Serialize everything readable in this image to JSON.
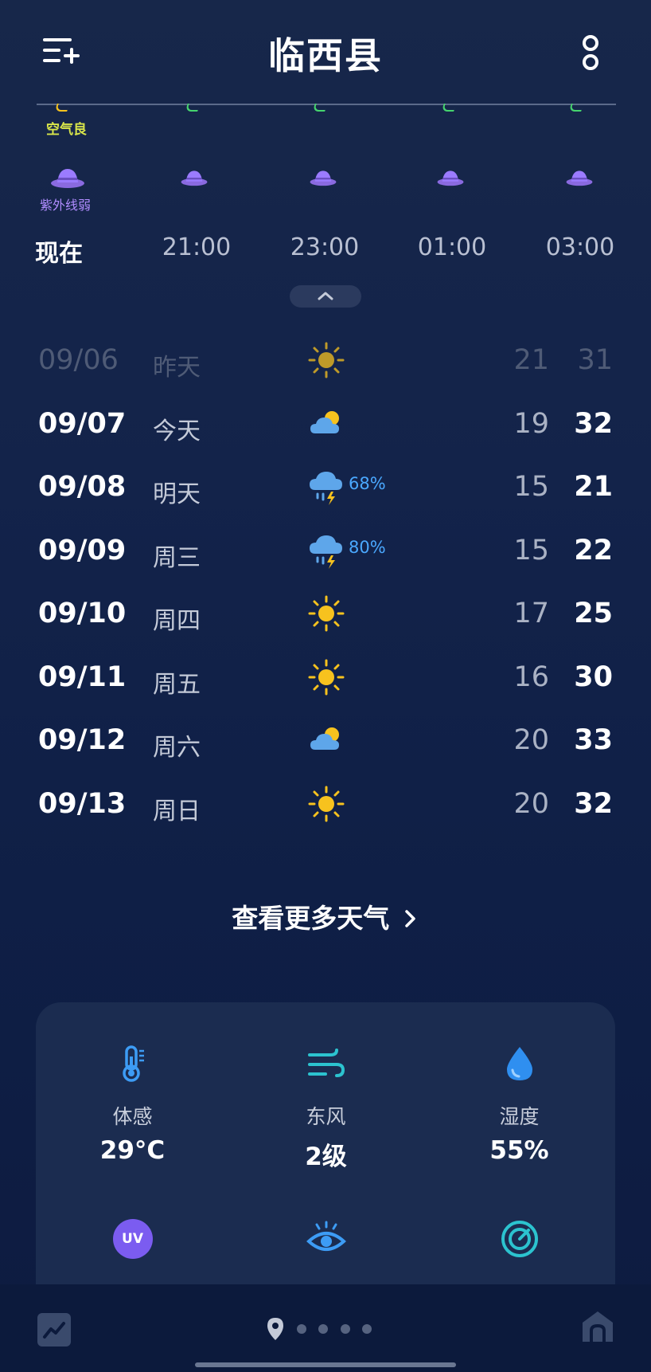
{
  "header": {
    "city": "临西县"
  },
  "hourly": {
    "aqi_label": "空气良",
    "uv_label": "紫外线弱",
    "hours": [
      "现在",
      "21:00",
      "23:00",
      "01:00",
      "03:00"
    ]
  },
  "daily": [
    {
      "date": "09/06",
      "day": "昨天",
      "icon": "sunny-icon",
      "precip": "",
      "low": "21",
      "high": "31",
      "dim": true
    },
    {
      "date": "09/07",
      "day": "今天",
      "icon": "partly-cloudy-icon",
      "precip": "",
      "low": "19",
      "high": "32"
    },
    {
      "date": "09/08",
      "day": "明天",
      "icon": "thunderstorm-icon",
      "precip": "68%",
      "low": "15",
      "high": "21"
    },
    {
      "date": "09/09",
      "day": "周三",
      "icon": "thunderstorm-icon",
      "precip": "80%",
      "low": "15",
      "high": "22"
    },
    {
      "date": "09/10",
      "day": "周四",
      "icon": "sunny-icon",
      "precip": "",
      "low": "17",
      "high": "25"
    },
    {
      "date": "09/11",
      "day": "周五",
      "icon": "sunny-icon",
      "precip": "",
      "low": "16",
      "high": "30"
    },
    {
      "date": "09/12",
      "day": "周六",
      "icon": "partly-cloudy-icon",
      "precip": "",
      "low": "20",
      "high": "33"
    },
    {
      "date": "09/13",
      "day": "周日",
      "icon": "sunny-icon",
      "precip": "",
      "low": "20",
      "high": "32"
    }
  ],
  "more_weather": "查看更多天气",
  "details": [
    {
      "icon": "thermometer-icon",
      "label": "体感",
      "value": "29°C"
    },
    {
      "icon": "wind-icon",
      "label": "东风",
      "value": "2级"
    },
    {
      "icon": "humidity-drop-icon",
      "label": "湿度",
      "value": "55%"
    },
    {
      "icon": "uv-icon",
      "label": "",
      "value": "",
      "badge": "UV"
    },
    {
      "icon": "eye-icon",
      "label": "",
      "value": ""
    },
    {
      "icon": "pressure-gauge-icon",
      "label": "",
      "value": ""
    }
  ],
  "colors": {
    "accent": "#4aa8ff",
    "sun": "#f7c21e",
    "aqi": "#d8e54a",
    "uv": "#9b7bff"
  }
}
